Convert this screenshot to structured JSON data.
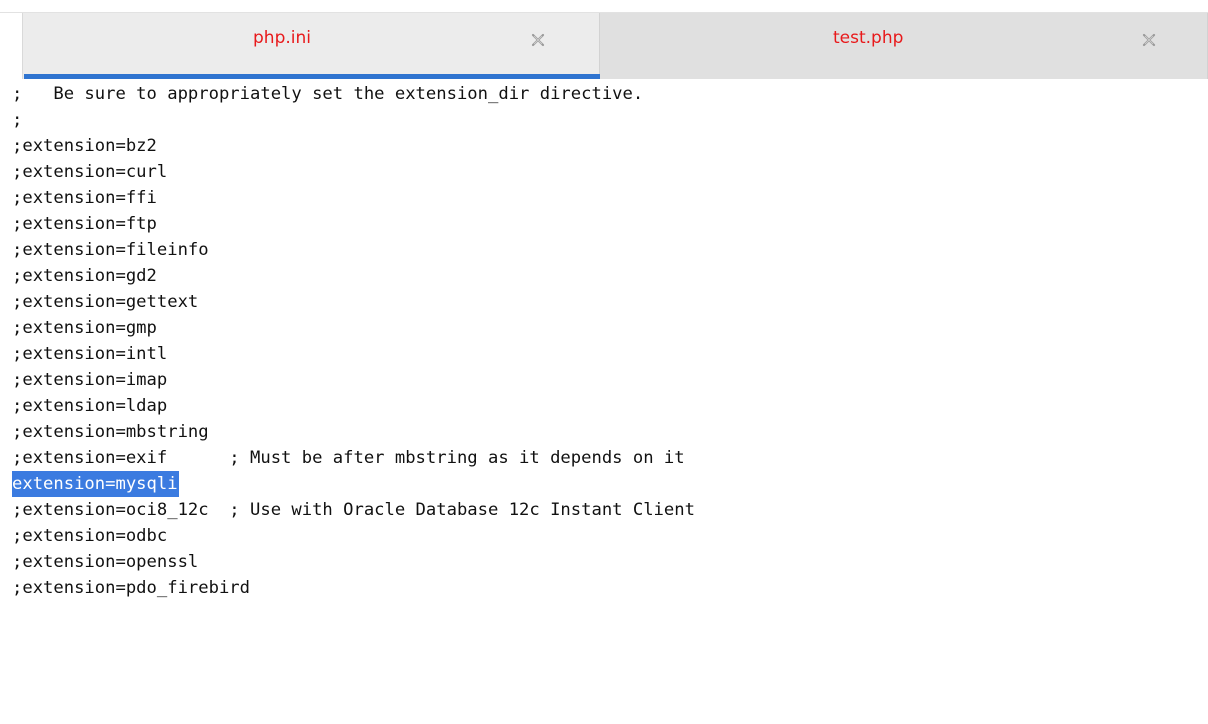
{
  "tabs": [
    {
      "label": "php.ini",
      "active": true
    },
    {
      "label": "test.php",
      "active": false
    }
  ],
  "colors": {
    "tab_label": "#e8191b",
    "active_indicator": "#2f74d0",
    "selection": "#3b7be0"
  },
  "editor": {
    "lines": [
      ";   Be sure to appropriately set the extension_dir directive.",
      ";",
      ";extension=bz2",
      ";extension=curl",
      ";extension=ffi",
      ";extension=ftp",
      ";extension=fileinfo",
      ";extension=gd2",
      ";extension=gettext",
      ";extension=gmp",
      ";extension=intl",
      ";extension=imap",
      ";extension=ldap",
      ";extension=mbstring",
      ";extension=exif      ; Must be after mbstring as it depends on it",
      "extension=mysqli",
      ";extension=oci8_12c  ; Use with Oracle Database 12c Instant Client",
      ";extension=odbc",
      ";extension=openssl",
      ";extension=pdo_firebird"
    ],
    "selected_text": "extension=mysqli"
  }
}
